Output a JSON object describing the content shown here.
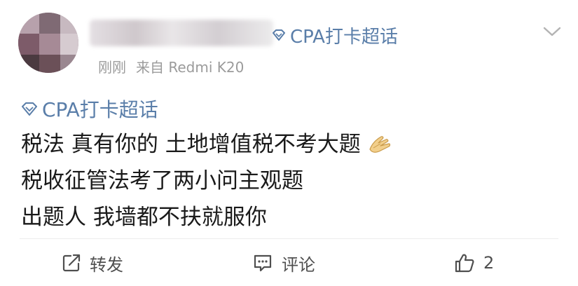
{
  "header": {
    "topic_label": "CPA打卡超话",
    "timestamp": "刚刚",
    "source": "来自 Redmi K20"
  },
  "post": {
    "topic_tag": "CPA打卡超话",
    "lines": [
      "税法 真有你的 土地增值税不考大题",
      "税收征管法考了两小问主观题",
      "出题人 我墙都不扶就服你"
    ]
  },
  "actions": {
    "repost_label": "转发",
    "comment_label": "评论",
    "like_count": "2"
  },
  "icons": {
    "topic": "diamond-icon",
    "menu": "chevron-down-icon",
    "repost": "repost-icon",
    "comment": "comment-icon",
    "like": "thumbs-up-icon",
    "emoji": "pray-hands-emoji"
  },
  "colors": {
    "topic_blue": "#5a7ea9",
    "meta_gray": "#9b9b9b"
  }
}
